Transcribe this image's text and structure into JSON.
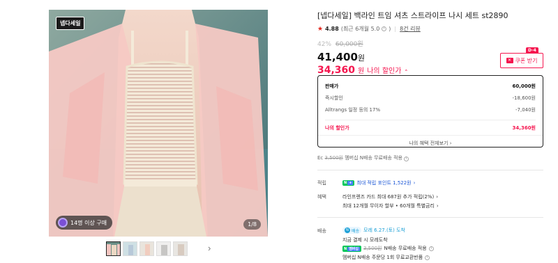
{
  "gallery": {
    "store_badge": "넵다세일",
    "buyers_text": "14명 이상 구매",
    "page_counter": "1/8",
    "prev_icon": "chevron-left-icon",
    "next_icon": "chevron-right-icon",
    "thumbnail_count": 5
  },
  "product": {
    "title": "[넵다세일] 백라인 트임 셔츠 스트라이프 나시 세트 st2890",
    "rating": "4.88",
    "rating_detail": "(최근 6개월 5.0",
    "reviews": "8건 리뷰",
    "discount_rate": "42%",
    "original_price": "60,000원",
    "price": "41,400",
    "price_unit": "원",
    "my_price": "34,360",
    "my_price_unit": "원",
    "my_price_label": "나의 할인가",
    "colors": {
      "accent": "#f5164f",
      "link": "#1a56d6",
      "npay": "#03c75a"
    }
  },
  "coupon": {
    "label": "쿠폰 받기",
    "dday": "D-4"
  },
  "breakdown": {
    "rows": [
      {
        "label": "판매가",
        "value": "60,000원"
      },
      {
        "label": "즉시할인",
        "value": "-18,600원"
      },
      {
        "label": "Alltrangs 일정 등의 17%",
        "value": "-7,040원"
      }
    ],
    "final_label": "나의 할인가",
    "final_value": "34,360원",
    "view_all": "나의 혜택 전체보기"
  },
  "shipping_note": {
    "prefix": "Ec",
    "strike": "3,500원",
    "text": "멤버십 N배송 무료배송 적용"
  },
  "points": {
    "label": "적립",
    "text": "최대 적립 포인트 1,522원"
  },
  "benefits": {
    "label": "혜택",
    "line1": "라인프렌즈 카드 최대 687원 추가 적립(2%)",
    "line2": "최대 12개월 무이자 할부 • 60개월 특별금리"
  },
  "delivery": {
    "label": "배송",
    "chip": "배송",
    "date": "모레 6.27.(토) 도착",
    "line2": "지금 결제 시 모레도착",
    "line3_strike": "3,500원",
    "line3": "N배송 무료배송 적용",
    "line4": "멤버십 N배송 주문당 1회 무료교환반품"
  }
}
